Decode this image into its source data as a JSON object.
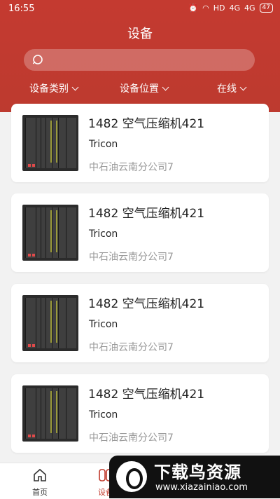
{
  "status": {
    "time": "16:55",
    "hd": "HD",
    "net1": "4G",
    "net2": "4G",
    "battery": "47"
  },
  "header": {
    "title": "设备"
  },
  "search": {
    "placeholder": ""
  },
  "filters": [
    {
      "label": "设备类别"
    },
    {
      "label": "设备位置"
    },
    {
      "label": "在线"
    }
  ],
  "devices": [
    {
      "name": "1482 空气压缩机421",
      "brand": "Tricon",
      "org": "中石油云南分公司7"
    },
    {
      "name": "1482 空气压缩机421",
      "brand": "Tricon",
      "org": "中石油云南分公司7"
    },
    {
      "name": "1482 空气压缩机421",
      "brand": "Tricon",
      "org": "中石油云南分公司7"
    },
    {
      "name": "1482 空气压缩机421",
      "brand": "Tricon",
      "org": "中石油云南分公司7"
    }
  ],
  "tabs": [
    {
      "label": "首页",
      "icon": "home-icon"
    },
    {
      "label": "设备",
      "icon": "device-icon",
      "active": true
    }
  ],
  "watermark": {
    "title": "下载鸟资源",
    "url": "www.xiazainiao.com"
  },
  "colors": {
    "brand": "#c0392b",
    "active_tab": "#c0392b"
  }
}
